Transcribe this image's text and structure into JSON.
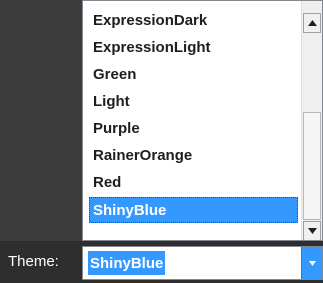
{
  "theme_dropdown": {
    "items": [
      {
        "label": "ExpressionDark"
      },
      {
        "label": "ExpressionLight"
      },
      {
        "label": "Green"
      },
      {
        "label": "Light"
      },
      {
        "label": "Purple"
      },
      {
        "label": "RainerOrange"
      },
      {
        "label": "Red"
      },
      {
        "label": "ShinyBlue",
        "selected": true
      }
    ]
  },
  "theme_selector": {
    "label": "Theme:",
    "value": "ShinyBlue"
  },
  "colors": {
    "accent": "#3399ff",
    "panel": "#3c3c3c",
    "bottom_bar": "#2e2e2e"
  },
  "icons": {
    "scroll_up": "triangle-up-icon",
    "scroll_down": "triangle-down-icon",
    "combo_arrow": "chevron-down-icon"
  }
}
